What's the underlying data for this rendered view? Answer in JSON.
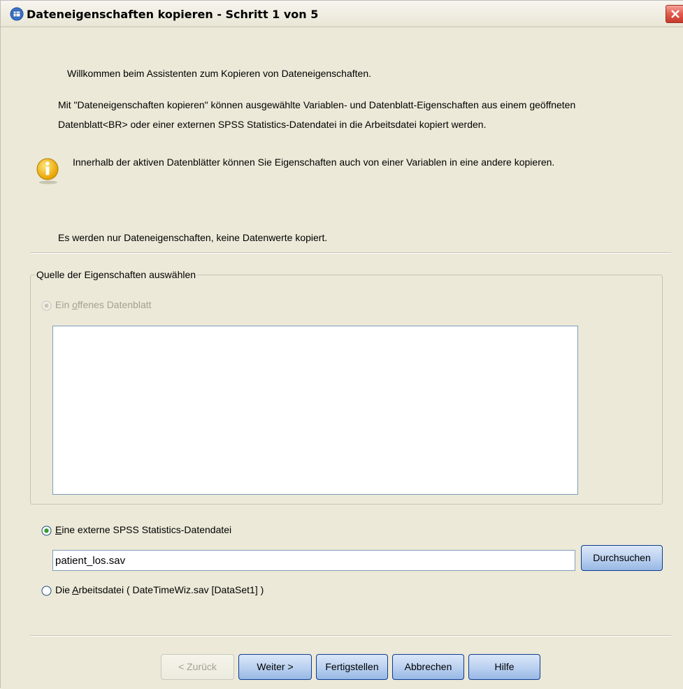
{
  "window": {
    "title": "Dateneigenschaften kopieren - Schritt 1 von 5"
  },
  "intro": {
    "welcome": "Willkommen beim Assistenten zum Kopieren von Dateneigenschaften.",
    "description_line1": "Mit \"Dateneigenschaften kopieren\" können ausgewählte Variablen- und Datenblatt-Eigenschaften aus einem geöffneten",
    "description_line2": "Datenblatt<BR> oder einer externen SPSS Statistics-Datendatei in die Arbeitsdatei kopiert werden.",
    "info_note": "Innerhalb der aktiven Datenblätter können Sie Eigenschaften auch von einer Variablen in eine andere kopieren.",
    "note": "Es werden nur Dateneigenschaften, keine Datenwerte kopiert."
  },
  "source_group": {
    "legend": "Quelle der Eigenschaften auswählen",
    "option_open_dataset": {
      "label_pre": "Ein ",
      "label_mnemonic": "o",
      "label_post": "ffenes Datenblatt",
      "selected": false,
      "enabled": false
    },
    "option_external_file": {
      "label_mnemonic": "E",
      "label_post": "ine externe SPSS Statistics-Datendatei",
      "selected": true,
      "enabled": true
    },
    "external_file_value": "patient_los.sav",
    "browse_label": "Durchsuchen",
    "option_working_file": {
      "label_pre": "Die ",
      "label_mnemonic": "A",
      "label_post": "rbeitsdatei ( DateTimeWiz.sav [DataSet1] )",
      "selected": false,
      "enabled": true
    }
  },
  "buttons": {
    "back": "< Zurück",
    "next": "Weiter >",
    "finish": "Fertigstellen",
    "cancel": "Abbrechen",
    "help": "Hilfe"
  },
  "colors": {
    "dialog_bg": "#ece9d8",
    "button_border": "#0d3c8f",
    "close_button": "#e05a4b"
  }
}
